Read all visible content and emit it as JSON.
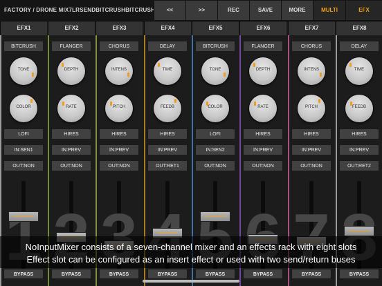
{
  "header": {
    "preset": "FACTORY / DRONE MIX7LRSENDBITCRUSHBITCRUSH",
    "buttons": [
      {
        "label": "<<",
        "active": false
      },
      {
        "label": ">>",
        "active": false
      },
      {
        "label": "REC",
        "active": false
      },
      {
        "label": "SAVE",
        "active": false
      },
      {
        "label": "MORE",
        "active": false
      },
      {
        "label": "MULTI",
        "active": true
      },
      {
        "label": "EFX",
        "active": true
      }
    ]
  },
  "channels": [
    {
      "name": "EFX1",
      "effect": "BITCRUSH",
      "knob1": "TONE",
      "knob2": "COLOR",
      "mode": "LOFI",
      "input": "IN:SEN1",
      "output": "OUT:NON",
      "number": "1",
      "level": 0.78,
      "bypass": "BYPASS",
      "edge": "#c9c9c9"
    },
    {
      "name": "EFX2",
      "effect": "FLANGER",
      "knob1": "DEPTH",
      "knob2": "RATE",
      "mode": "HIRES",
      "input": "IN:PREV",
      "output": "OUT:NON",
      "number": "2",
      "level": 0.38,
      "bypass": "BYPASS",
      "edge": "#8fb34a"
    },
    {
      "name": "EFX3",
      "effect": "CHORUS",
      "knob1": "INTENS",
      "knob2": "PITCH",
      "mode": "HIRES",
      "input": "IN:PREV",
      "output": "OUT:NON",
      "number": "3",
      "level": 0.22,
      "bypass": "BYPASS",
      "edge": "#a8b84a"
    },
    {
      "name": "EFX4",
      "effect": "DELAY",
      "knob1": "TIME",
      "knob2": "FEEDB",
      "mode": "HIRES",
      "input": "IN:PREV",
      "output": "OUT:RET1",
      "number": "4",
      "level": 0.46,
      "bypass": "BYPASS",
      "edge": "#d9a02a"
    },
    {
      "name": "EFX5",
      "effect": "BITCRUSH",
      "knob1": "TONE",
      "knob2": "COLOR",
      "mode": "LOFI",
      "input": "IN:SEN2",
      "output": "OUT:NON",
      "number": "5",
      "level": 0.78,
      "bypass": "BYPASS",
      "edge": "#4e8fd0"
    },
    {
      "name": "EFX6",
      "effect": "FLANGER",
      "knob1": "DEPTH",
      "knob2": "RATE",
      "mode": "HIRES",
      "input": "IN:PREV",
      "output": "OUT:NON",
      "number": "6",
      "level": 0.34,
      "bypass": "BYPASS",
      "edge": "#8c5ac4"
    },
    {
      "name": "EFX7",
      "effect": "CHORUS",
      "knob1": "INTENS",
      "knob2": "PITCH",
      "mode": "HIRES",
      "input": "IN:PREV",
      "output": "OUT:NON",
      "number": "7",
      "level": 0.3,
      "bypass": "BYPASS",
      "edge": "#d46aa0"
    },
    {
      "name": "EFX8",
      "effect": "DELAY",
      "knob1": "TIME",
      "knob2": "FEEDB",
      "mode": "HIRES",
      "input": "IN:PREV",
      "output": "OUT:RET2",
      "number": "8",
      "level": 0.5,
      "bypass": "BYPASS",
      "edge": "#c9c9c9"
    }
  ],
  "caption": {
    "line1": "NoInputMixer consists of a seven-channel mixer and an effects rack with eight slots",
    "line2": "Effect slot can be configured as an insert effect or used with two send/return buses"
  },
  "colors": {
    "accent": "#f2a31c",
    "background": "#1b1b1b",
    "button": "#414141"
  }
}
